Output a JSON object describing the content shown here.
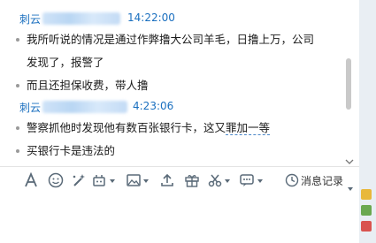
{
  "messages": [
    {
      "sender": "刺云",
      "time": "14:22:00",
      "lines": [
        [
          "我所听说的情况是通过作弊撸大公司羊毛，日撸上万，公司",
          "发现了，报警了"
        ],
        [
          "而且还担保收费，带人撸"
        ]
      ]
    },
    {
      "sender": "刺云",
      "time": "4:23:06",
      "lines": [
        [
          "警察抓他时发现他有数百张银行卡，这又",
          "罪加一等"
        ],
        [
          "买银行卡是违法的"
        ]
      ]
    }
  ],
  "toolbar": {
    "icons": [
      "font-icon",
      "emoji-icon",
      "magic-icon",
      "screenshot-icon",
      "image-icon",
      "upload-icon",
      "gift-icon",
      "scissors-icon",
      "more-icon"
    ],
    "history_label": "消息记录"
  },
  "colors": {
    "sender": "#1a6fbf",
    "icon": "#5a6a78"
  }
}
